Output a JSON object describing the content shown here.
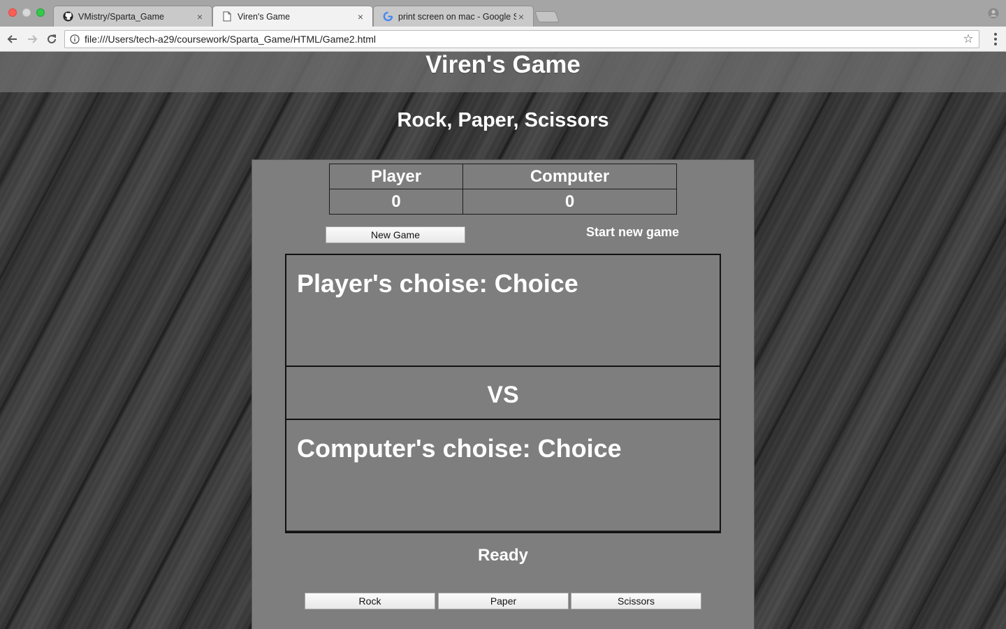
{
  "browser": {
    "tabs": [
      {
        "title": "VMistry/Sparta_Game",
        "close": "×"
      },
      {
        "title": "Viren's Game",
        "close": "×"
      },
      {
        "title": "print screen on mac - Google S",
        "close": "×"
      }
    ],
    "url": "file:///Users/tech-a29/coursework/Sparta_Game/HTML/Game2.html"
  },
  "page": {
    "title": "Viren's Game",
    "subtitle": "Rock, Paper, Scissors",
    "scoreboard": {
      "headers": [
        "Player",
        "Computer"
      ],
      "scores": [
        "0",
        "0"
      ]
    },
    "new_game_label": "New Game",
    "new_game_note": "Start new game",
    "player_choice": "Player's choise: Choice",
    "vs_label": "VS",
    "computer_choice": "Computer's choise: Choice",
    "status": "Ready",
    "moves": [
      "Rock",
      "Paper",
      "Scissors"
    ]
  },
  "icons": {
    "tab1": "github-icon",
    "tab2": "page-icon",
    "tab3": "google-icon",
    "nav": [
      "back-arrow-icon",
      "forward-arrow-icon",
      "reload-icon"
    ],
    "omnibox": [
      "info-icon",
      "star-icon"
    ],
    "profile": "profile-icon",
    "menu": "kebab-menu-icon"
  },
  "colors": {
    "panel": "#7e7e7e",
    "header_bar": "#6e6e6e",
    "text": "#ffffff",
    "tab_active": "#f2f2f2",
    "tabstrip": "#a5a5a5"
  }
}
